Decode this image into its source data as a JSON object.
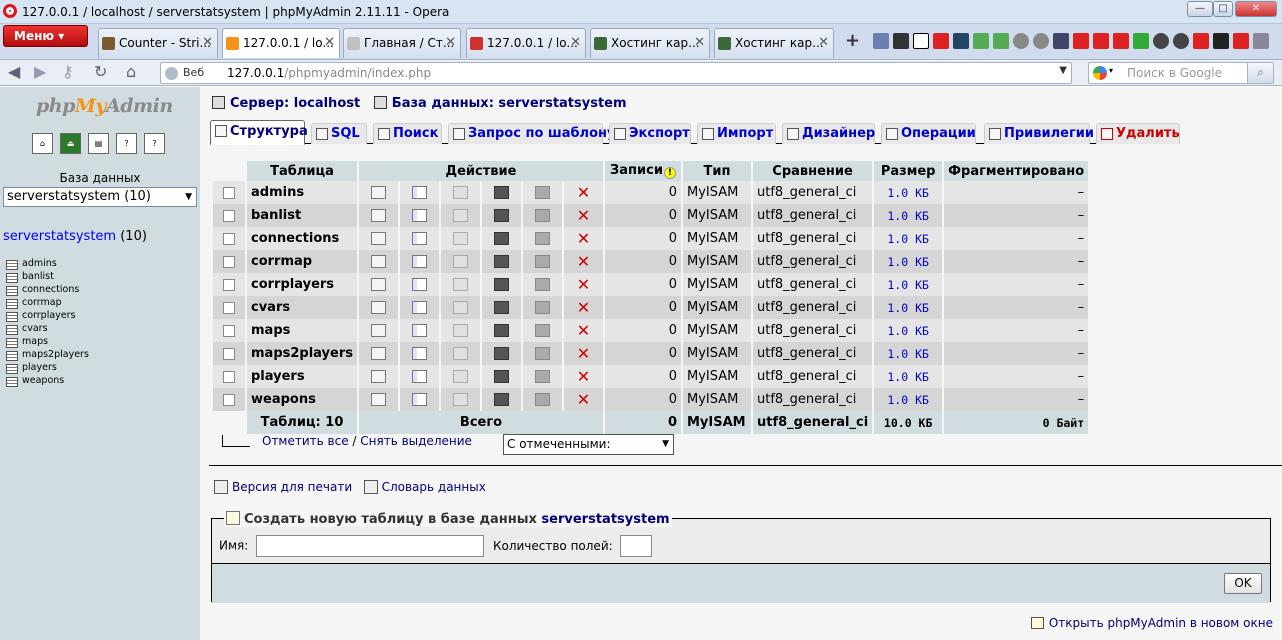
{
  "window": {
    "title": "127.0.0.1 / localhost / serverstatsystem | phpMyAdmin 2.11.11 - Opera",
    "controls": [
      "—",
      "□",
      "✕"
    ]
  },
  "browser": {
    "menu_label": "Меню",
    "tabs": [
      {
        "label": "Counter - Stri...",
        "icon_color": "#7a5a2e"
      },
      {
        "label": "127.0.0.1 / lo...",
        "icon_color": "#f39418",
        "active": true
      },
      {
        "label": "Главная / Ст...",
        "icon_color": "#c0c0c0"
      },
      {
        "label": "127.0.0.1 / lo...",
        "icon_color": "#d03030"
      },
      {
        "label": "Хостинг кар...",
        "icon_color": "#3a6a3a"
      },
      {
        "label": "Хостинг кар...",
        "icon_color": "#3a6a3a"
      }
    ],
    "new_tab": "+",
    "web_label": "Веб",
    "url_host": "127.0.0.1",
    "url_path": "/phpmyadmin/index.php",
    "search_placeholder": "Поиск в Google"
  },
  "sidebar": {
    "logo_php": "php",
    "logo_my": "My",
    "logo_admin": "Admin",
    "db_label": "База данных",
    "db_select": "serverstatsystem (10)",
    "db_name": "serverstatsystem",
    "db_count": "(10)",
    "tables": [
      "admins",
      "banlist",
      "connections",
      "corrmap",
      "corrplayers",
      "cvars",
      "maps",
      "maps2players",
      "players",
      "weapons"
    ]
  },
  "breadcrumb": {
    "server_label": "Сервер: localhost",
    "db_label": "База данных: serverstatsystem"
  },
  "tabs": {
    "structure": "Структура",
    "sql": "SQL",
    "search": "Поиск",
    "query": "Запрос по шаблону",
    "export": "Экспорт",
    "import": "Импорт",
    "designer": "Дизайнер",
    "operations": "Операции",
    "privileges": "Привилегии",
    "drop": "Удалить"
  },
  "table": {
    "headers": {
      "name": "Таблица",
      "action": "Действие",
      "records": "Записи",
      "type": "Тип",
      "collation": "Сравнение",
      "size": "Размер",
      "overhead": "Фрагментировано"
    },
    "rows": [
      {
        "name": "admins",
        "records": "0",
        "type": "MyISAM",
        "collation": "utf8_general_ci",
        "size": "1.0 КБ",
        "overhead": "–"
      },
      {
        "name": "banlist",
        "records": "0",
        "type": "MyISAM",
        "collation": "utf8_general_ci",
        "size": "1.0 КБ",
        "overhead": "–"
      },
      {
        "name": "connections",
        "records": "0",
        "type": "MyISAM",
        "collation": "utf8_general_ci",
        "size": "1.0 КБ",
        "overhead": "–"
      },
      {
        "name": "corrmap",
        "records": "0",
        "type": "MyISAM",
        "collation": "utf8_general_ci",
        "size": "1.0 КБ",
        "overhead": "–"
      },
      {
        "name": "corrplayers",
        "records": "0",
        "type": "MyISAM",
        "collation": "utf8_general_ci",
        "size": "1.0 КБ",
        "overhead": "–"
      },
      {
        "name": "cvars",
        "records": "0",
        "type": "MyISAM",
        "collation": "utf8_general_ci",
        "size": "1.0 КБ",
        "overhead": "–"
      },
      {
        "name": "maps",
        "records": "0",
        "type": "MyISAM",
        "collation": "utf8_general_ci",
        "size": "1.0 КБ",
        "overhead": "–"
      },
      {
        "name": "maps2players",
        "records": "0",
        "type": "MyISAM",
        "collation": "utf8_general_ci",
        "size": "1.0 КБ",
        "overhead": "–"
      },
      {
        "name": "players",
        "records": "0",
        "type": "MyISAM",
        "collation": "utf8_general_ci",
        "size": "1.0 КБ",
        "overhead": "–"
      },
      {
        "name": "weapons",
        "records": "0",
        "type": "MyISAM",
        "collation": "utf8_general_ci",
        "size": "1.0 КБ",
        "overhead": "–"
      }
    ],
    "footer": {
      "tables": "Таблиц: 10",
      "total": "Всего",
      "records": "0",
      "type": "MyISAM",
      "collation": "utf8_general_ci",
      "size": "10.0 КБ",
      "overhead": "0 Байт"
    }
  },
  "bulk": {
    "check_all": "Отметить все",
    "separator": " / ",
    "uncheck_all": "Снять выделение",
    "with_selected": "С отмеченными:"
  },
  "links": {
    "print": "Версия для печати",
    "dictionary": "Словарь данных"
  },
  "create": {
    "legend": "Создать новую таблицу в базе данных",
    "db": "serverstatsystem",
    "name_label": "Имя:",
    "fields_label": "Количество полей:",
    "ok": "OK"
  },
  "new_window": "Открыть phpMyAdmin в новом окне"
}
